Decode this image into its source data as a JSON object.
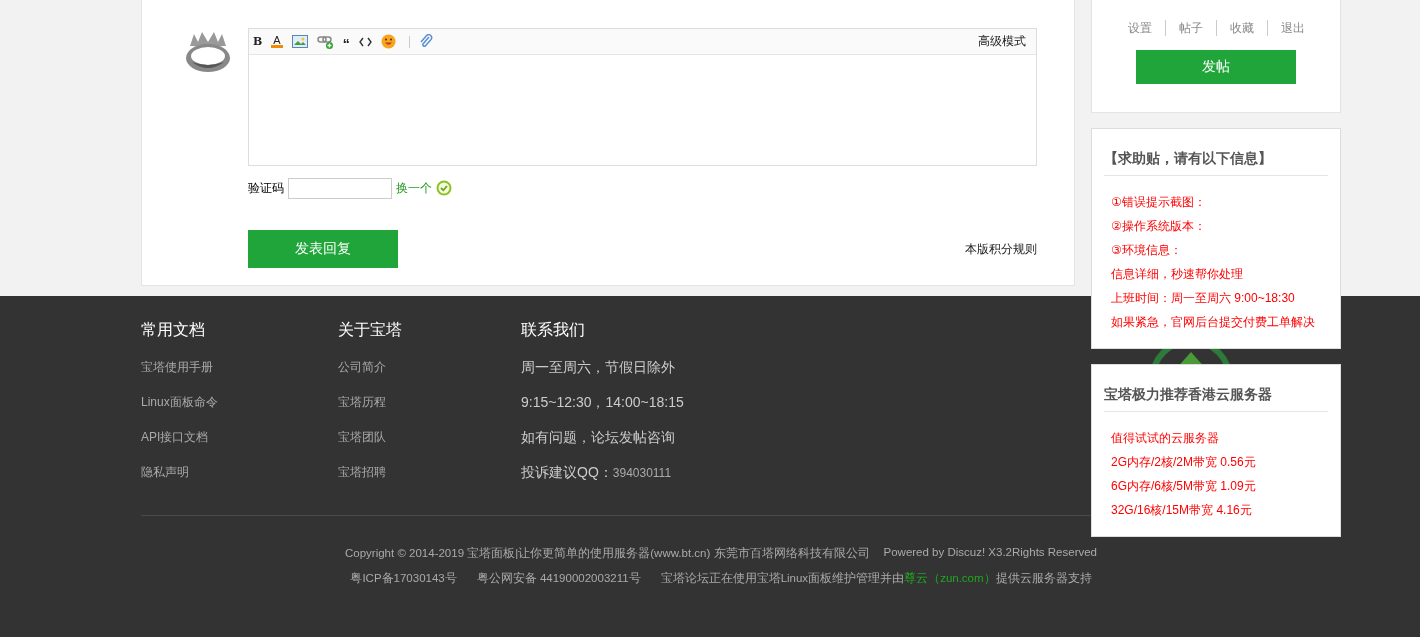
{
  "reply_form": {
    "toolbar": [
      {
        "kind": "bold",
        "glyph": "B"
      },
      {
        "kind": "color",
        "glyph": "A"
      },
      {
        "kind": "image"
      },
      {
        "kind": "link"
      },
      {
        "kind": "quote",
        "glyph": "“"
      },
      {
        "kind": "code"
      },
      {
        "kind": "emoji"
      },
      {
        "kind": "separator"
      },
      {
        "kind": "attach"
      }
    ],
    "mode_toggle": "高级模式",
    "captcha_label": "验证码",
    "captcha_refresh": "换一个",
    "submit_button": "发表回复",
    "rules_link": "本版积分规则"
  },
  "user_panel": {
    "links": [
      "设置",
      "帖子",
      "收藏",
      "退出"
    ],
    "post_button": "发帖"
  },
  "footer": {
    "columns": [
      {
        "title": "常用文档",
        "kind": "links",
        "items": [
          {
            "text": "宝塔使用手册"
          },
          {
            "text": "Linux面板命令"
          },
          {
            "text": "API接口文档"
          },
          {
            "text": "隐私声明"
          }
        ]
      },
      {
        "title": "关于宝塔",
        "kind": "links",
        "items": [
          {
            "text": "公司简介"
          },
          {
            "text": "宝塔历程"
          },
          {
            "text": "宝塔团队"
          },
          {
            "text": "宝塔招聘"
          }
        ]
      },
      {
        "title": "联系我们",
        "kind": "contact",
        "items": [
          {
            "text": "周一至周六，节假日除外"
          },
          {
            "text": "9:15~12:30，14:00~18:15"
          },
          {
            "text": "如有问题，论坛发帖咨询"
          },
          {
            "text": "投诉建议QQ：",
            "number": "394030111"
          }
        ]
      }
    ],
    "copyright": [
      "Copyright © 2014-2019 宝塔面板|让你更简单的使用服务器(www.bt.cn) 东莞市百塔网络科技有限公司",
      "Powered by Discuz! X3.2Rights Reserved"
    ],
    "records": [
      "粤ICP备17030143号",
      "粤公网安备 44190002003211号"
    ],
    "support": {
      "before": "宝塔论坛正在使用宝塔Linux面板维护管理并由",
      "link": "尊云（zun.com）",
      "after": "提供云服务器支持"
    }
  },
  "float_panels": [
    {
      "title": "【求助贴，请有以下信息】",
      "items": [
        "①错误提示截图：",
        "②操作系统版本：",
        "③环境信息：",
        "信息详细，秒速帮你处理",
        "上班时间：周一至周六 9:00~18:30",
        "如果紧急，官网后台提交付费工单解决"
      ]
    },
    {
      "title": "宝塔极力推荐香港云服务器",
      "items": [
        "值得试试的云服务器",
        "2G内存/2核/2M带宽 0.56元",
        "6G内存/6核/5M带宽 1.09元",
        "32G/16核/15M带宽 4.16元"
      ]
    }
  ]
}
